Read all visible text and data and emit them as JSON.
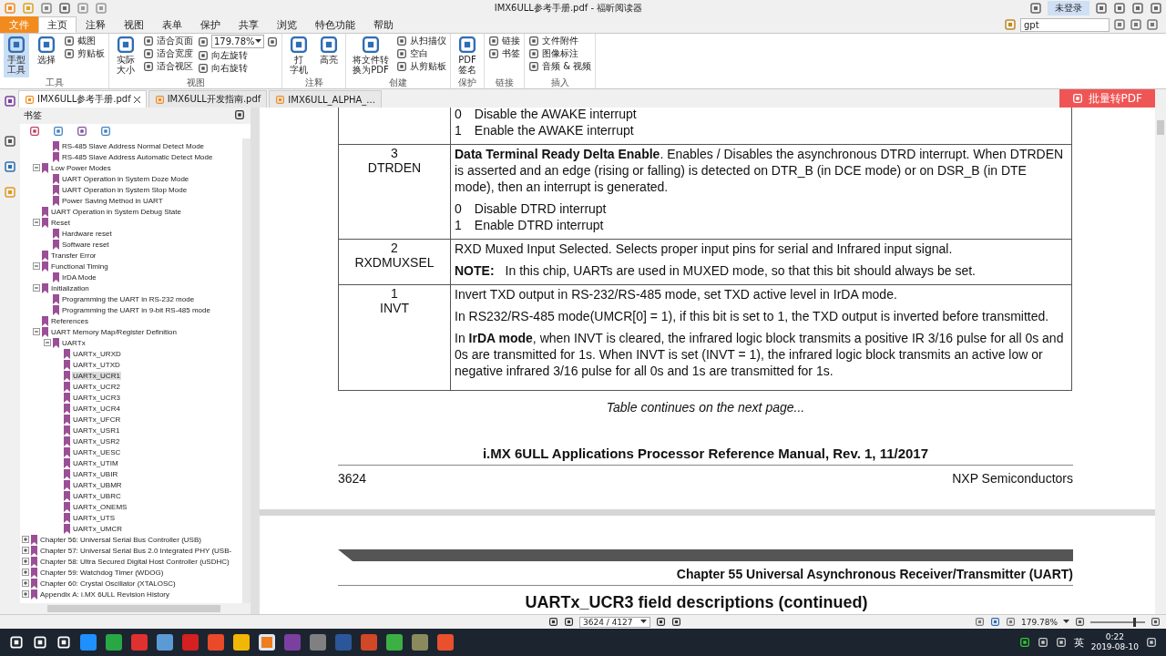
{
  "window": {
    "title": "IMX6ULL参考手册.pdf - 福昕阅读器",
    "account": "未登录"
  },
  "menu_tabs": [
    {
      "label": "文件",
      "kind": "file",
      "selected": false
    },
    {
      "label": "主页",
      "kind": "tab",
      "selected": true
    },
    {
      "label": "注释",
      "kind": "tab",
      "selected": false
    },
    {
      "label": "视图",
      "kind": "tab",
      "selected": false
    },
    {
      "label": "表单",
      "kind": "tab",
      "selected": false
    },
    {
      "label": "保护",
      "kind": "tab",
      "selected": false
    },
    {
      "label": "共享",
      "kind": "tab",
      "selected": false
    },
    {
      "label": "浏览",
      "kind": "tab",
      "selected": false
    },
    {
      "label": "特色功能",
      "kind": "tab",
      "selected": false
    },
    {
      "label": "帮助",
      "kind": "tab",
      "selected": false
    }
  ],
  "search": {
    "value": "gpt"
  },
  "ribbon": {
    "groups": [
      {
        "label": "工具",
        "items": [
          {
            "kind": "large",
            "lines": [
              "手型",
              "工具"
            ],
            "selected": true
          },
          {
            "kind": "large",
            "lines": [
              "选择"
            ],
            "selected": false
          },
          {
            "kind": "column",
            "items": [
              {
                "kind": "small",
                "label": "截图"
              },
              {
                "kind": "small",
                "label": "剪贴板"
              }
            ]
          }
        ]
      },
      {
        "label": "视图",
        "items": [
          {
            "kind": "large",
            "lines": [
              "实际",
              "大小"
            ],
            "selected": false
          },
          {
            "kind": "column",
            "items": [
              {
                "kind": "small",
                "label": "适合页面"
              },
              {
                "kind": "small",
                "label": "适合宽度"
              },
              {
                "kind": "small",
                "label": "适合视区"
              }
            ]
          },
          {
            "kind": "column",
            "items": [
              {
                "kind": "zoom",
                "label": "179.78%"
              },
              {
                "kind": "small",
                "label": "向左旋转"
              },
              {
                "kind": "small",
                "label": "向右旋转"
              }
            ]
          }
        ]
      },
      {
        "label": "注释",
        "items": [
          {
            "kind": "large",
            "lines": [
              "打",
              "字机"
            ],
            "selected": false
          },
          {
            "kind": "large",
            "lines": [
              "高亮"
            ],
            "selected": false
          }
        ]
      },
      {
        "label": "创建",
        "items": [
          {
            "kind": "large",
            "lines": [
              "将文件转",
              "换为PDF"
            ],
            "selected": false
          },
          {
            "kind": "column",
            "items": [
              {
                "kind": "small",
                "label": "从扫描仪"
              },
              {
                "kind": "small",
                "label": "空白"
              },
              {
                "kind": "small",
                "label": "从剪贴板"
              }
            ]
          }
        ]
      },
      {
        "label": "保护",
        "items": [
          {
            "kind": "large",
            "lines": [
              "PDF",
              "签名"
            ],
            "selected": false
          }
        ]
      },
      {
        "label": "链接",
        "items": [
          {
            "kind": "column",
            "items": [
              {
                "kind": "small",
                "label": "链接"
              },
              {
                "kind": "small",
                "label": "书签"
              }
            ]
          }
        ]
      },
      {
        "label": "插入",
        "items": [
          {
            "kind": "column",
            "items": [
              {
                "kind": "small",
                "label": "文件附件"
              },
              {
                "kind": "small",
                "label": "图像标注"
              },
              {
                "kind": "small",
                "label": "音频 & 视频"
              }
            ]
          }
        ]
      }
    ]
  },
  "doc_tabs": [
    {
      "label": "IMX6ULL参考手册.pdf",
      "selected": true
    },
    {
      "label": "IMX6ULL开发指南.pdf",
      "selected": false
    },
    {
      "label": "IMX6ULL_ALPHA_...",
      "selected": false
    }
  ],
  "convert_button": "批量转PDF",
  "bookmarks": {
    "title": "书签",
    "tree": [
      {
        "children": [
          {
            "children": [
              {
                "label": "RS-485 Slave Address Normal Detect Mode",
                "selected": false
              },
              {
                "label": "RS-485 Slave Address Automatic Detect Mode",
                "selected": false
              }
            ]
          },
          {
            "label": "Low Power Modes",
            "selected": false,
            "expanded": true,
            "children": [
              {
                "label": "UART Operation in System Doze Mode",
                "selected": false
              },
              {
                "label": "UART Operation in System Stop Mode",
                "selected": false
              },
              {
                "label": "Power Saving Method in UART",
                "selected": false
              }
            ]
          },
          {
            "label": "UART Operation in System Debug State",
            "selected": false
          },
          {
            "label": "Reset",
            "selected": false,
            "expanded": true,
            "children": [
              {
                "label": "Hardware reset",
                "selected": false
              },
              {
                "label": "Software reset",
                "selected": false
              }
            ]
          },
          {
            "label": "Transfer Error",
            "selected": false
          },
          {
            "label": "Functional Timing",
            "selected": false,
            "expanded": true,
            "children": [
              {
                "label": "IrDA Mode",
                "selected": false
              }
            ]
          },
          {
            "label": "Initialization",
            "selected": false,
            "expanded": true,
            "children": [
              {
                "label": "Programming the UART in RS-232 mode",
                "selected": false
              },
              {
                "label": "Programming the UART in 9-bit RS-485 mode",
                "selected": false
              }
            ]
          },
          {
            "label": "References",
            "selected": false
          },
          {
            "label": "UART Memory Map/Register Definition",
            "selected": false,
            "expanded": true,
            "children": [
              {
                "label": "UARTx",
                "selected": false,
                "expanded": true,
                "children": [
                  {
                    "label": "UARTx_URXD",
                    "selected": false
                  },
                  {
                    "label": "UARTx_UTXD",
                    "selected": false
                  },
                  {
                    "label": "UARTx_UCR1",
                    "selected": true
                  },
                  {
                    "label": "UARTx_UCR2",
                    "selected": false
                  },
                  {
                    "label": "UARTx_UCR3",
                    "selected": false
                  },
                  {
                    "label": "UARTx_UCR4",
                    "selected": false
                  },
                  {
                    "label": "UARTx_UFCR",
                    "selected": false
                  },
                  {
                    "label": "UARTx_USR1",
                    "selected": false
                  },
                  {
                    "label": "UARTx_USR2",
                    "selected": false
                  },
                  {
                    "label": "UARTx_UESC",
                    "selected": false
                  },
                  {
                    "label": "UARTx_UTIM",
                    "selected": false
                  },
                  {
                    "label": "UARTx_UBIR",
                    "selected": false
                  },
                  {
                    "label": "UARTx_UBMR",
                    "selected": false
                  },
                  {
                    "label": "UARTx_UBRC",
                    "selected": false
                  },
                  {
                    "label": "UARTx_ONEMS",
                    "selected": false
                  },
                  {
                    "label": "UARTx_UTS",
                    "selected": false
                  },
                  {
                    "label": "UARTx_UMCR",
                    "selected": false
                  }
                ]
              }
            ]
          }
        ]
      },
      {
        "label": "Chapter 56: Universal Serial Bus Controller (USB)",
        "selected": false,
        "expanded": false
      },
      {
        "label": "Chapter 57: Universal Serial Bus 2.0 Integrated PHY (USB-",
        "selected": false,
        "expanded": false
      },
      {
        "label": "Chapter 58: Ultra Secured Digital Host Controller (uSDHC)",
        "selected": false,
        "expanded": false
      },
      {
        "label": "Chapter 59: Watchdog Timer (WDOG)",
        "selected": false,
        "expanded": false
      },
      {
        "label": "Chapter 60: Crystal Oscillator (XTALOSC)",
        "selected": false,
        "expanded": false
      },
      {
        "label": "Appendix A: i.MX 6ULL Revision History",
        "selected": false,
        "expanded": false
      }
    ]
  },
  "page": {
    "table_rows": [
      {
        "field": [],
        "blocks": [
          {
            "kind": "option",
            "value": "0",
            "text": "Disable the AWAKE interrupt"
          },
          {
            "kind": "option",
            "value": "1",
            "text": "Enable the AWAKE interrupt"
          }
        ]
      },
      {
        "field": [
          "3",
          "DTRDEN"
        ],
        "blocks": [
          {
            "kind": "para",
            "text": "**Data Terminal Ready Delta Enable**. Enables / Disables the asynchronous DTRD interrupt. When DTRDEN is asserted and an edge (rising or falling) is detected on DTR_B (in DCE mode) or on DSR_B (in DTE mode), then an interrupt is generated."
          },
          {
            "kind": "option",
            "value": "0",
            "text": "Disable DTRD interrupt"
          },
          {
            "kind": "option",
            "value": "1",
            "text": "Enable DTRD interrupt"
          }
        ]
      },
      {
        "field": [
          "2",
          "RXDMUXSEL"
        ],
        "blocks": [
          {
            "kind": "para",
            "text": "RXD Muxed Input Selected. Selects proper input pins for serial and Infrared input signal."
          },
          {
            "kind": "note",
            "label": "NOTE:",
            "text": "In this chip, UARTs are used in MUXED mode, so that this bit should always be set."
          }
        ]
      },
      {
        "field": [
          "1",
          "INVT"
        ],
        "blocks": [
          {
            "kind": "para",
            "text": "Invert TXD output in RS-232/RS-485 mode, set TXD active level in IrDA mode."
          },
          {
            "kind": "para",
            "text": "In RS232/RS-485 mode(UMCR[0] = 1), if this bit is set to 1, the TXD output is inverted before transmitted."
          },
          {
            "kind": "para",
            "text": "In **IrDA mode**, when INVT is cleared, the infrared logic block transmits a positive IR 3/16 pulse for all 0s and 0s are transmitted for 1s. When INVT is set (INVT = 1), the infrared logic block transmits an active low or negative infrared 3/16 pulse for all 0s and 1s are transmitted for 1s."
          }
        ]
      }
    ],
    "continues": "Table continues on the next page...",
    "footer_title": "i.MX 6ULL Applications Processor Reference Manual, Rev. 1, 11/2017",
    "page_number": "3624",
    "company": "NXP Semiconductors",
    "next_chapter": "Chapter 55 Universal Asynchronous Receiver/Transmitter (UART)",
    "next_title": "UARTx_UCR3 field descriptions (continued)"
  },
  "status_bar": {
    "page_field": "3624 / 4127",
    "zoom": "179.78%",
    "zoom_slider": {
      "level": 0.78
    }
  },
  "taskbar": {
    "apps": [
      {
        "color": "#1e90ff",
        "selected": false
      },
      {
        "color": "#28a745",
        "selected": false
      },
      {
        "color": "#e03030",
        "selected": false
      },
      {
        "color": "#5b9bd5",
        "selected": false
      },
      {
        "color": "#d42020",
        "selected": false
      },
      {
        "color": "#e84a2a",
        "selected": false
      },
      {
        "color": "#f2b705",
        "selected": false
      },
      {
        "color": "#f07c1e",
        "selected": true
      },
      {
        "color": "#7b3fa0",
        "selected": false
      },
      {
        "color": "#808080",
        "selected": false
      },
      {
        "color": "#2b579a",
        "selected": false
      },
      {
        "color": "#d24726",
        "selected": false
      },
      {
        "color": "#3cb043",
        "selected": false
      },
      {
        "color": "#8a8a5c",
        "selected": false
      },
      {
        "color": "#e8502e",
        "selected": false
      }
    ],
    "ime": "英",
    "time": "0:22",
    "date": "2019-08-10"
  }
}
